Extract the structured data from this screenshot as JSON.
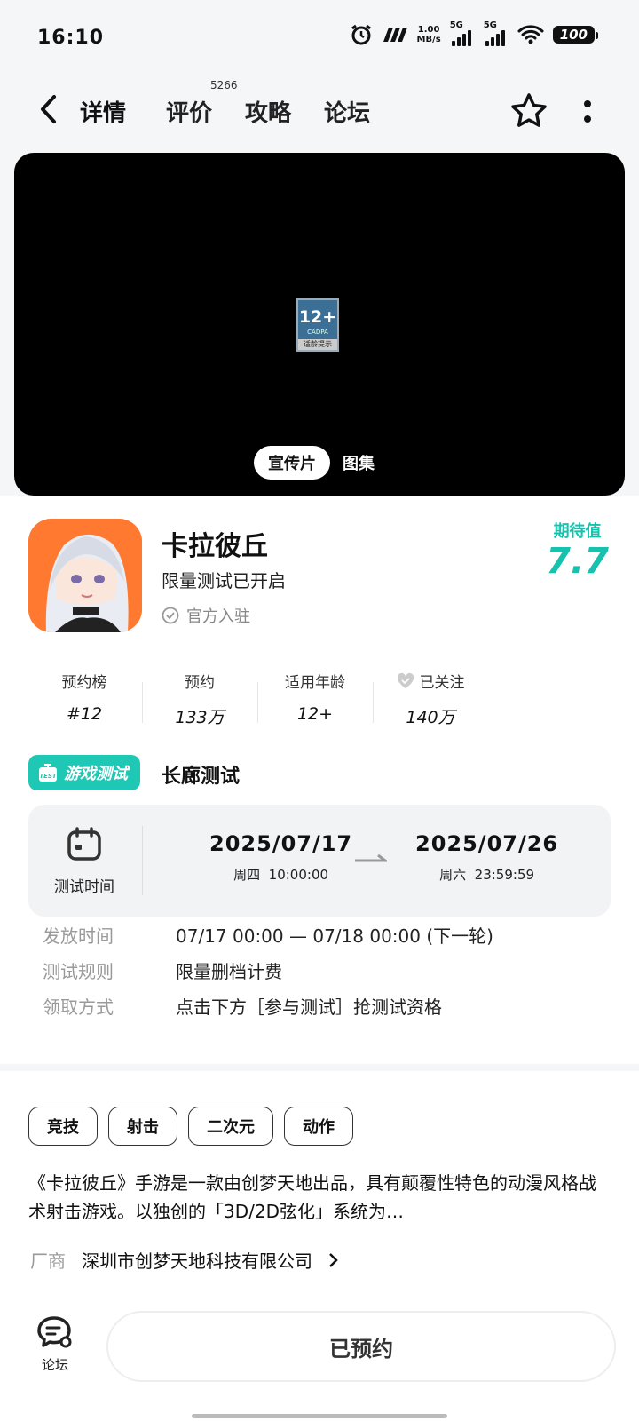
{
  "status": {
    "time": "16:10",
    "speed_value": "1.00",
    "speed_unit": "MB/s",
    "net1": "5G",
    "net2": "5G",
    "battery": "100"
  },
  "nav": {
    "tabs": [
      {
        "label": "详情",
        "active": true
      },
      {
        "label": "评价",
        "badge": "5266"
      },
      {
        "label": "攻略"
      },
      {
        "label": "论坛"
      }
    ]
  },
  "video": {
    "rating_num": "12+",
    "rating_org": "CADPA",
    "rating_tip": "适龄提示",
    "tabs": [
      {
        "label": "宣传片",
        "active": true
      },
      {
        "label": "图集"
      }
    ]
  },
  "app": {
    "title": "卡拉彼丘",
    "subtitle": "限量测试已开启",
    "official": "官方入驻",
    "expect_label": "期待值",
    "expect_value": "7.7"
  },
  "stats": [
    {
      "key": "预约榜",
      "value": "#12"
    },
    {
      "key": "预约",
      "value": "133万"
    },
    {
      "key": "适用年龄",
      "value": "12+"
    },
    {
      "key": "已关注",
      "value": "140万"
    }
  ],
  "test": {
    "tag": "游戏测试",
    "name": "长廊测试",
    "time_label": "测试时间",
    "start_date": "2025/07/17",
    "start_weekday": "周四",
    "start_time": "10:00:00",
    "end_date": "2025/07/26",
    "end_weekday": "周六",
    "end_time": "23:59:59",
    "info": [
      {
        "key": "发放时间",
        "value": "07/17 00:00 — 07/18 00:00 (下一轮)"
      },
      {
        "key": "测试规则",
        "value": "限量删档计费"
      },
      {
        "key": "领取方式",
        "value": "点击下方［参与测试］抢测试资格"
      }
    ]
  },
  "tags": [
    "竞技",
    "射击",
    "二次元",
    "动作"
  ],
  "description": "《卡拉彼丘》手游是一款由创梦天地出品，具有颠覆性特色的动漫风格战术射击游戏。以独创的「3D/2D弦化」系统为…",
  "vendor": {
    "label": "厂商",
    "name": "深圳市创梦天地科技有限公司"
  },
  "bottom": {
    "forum_label": "论坛",
    "reserve_label": "已预约"
  },
  "colors": {
    "accent": "#1ec8b4"
  }
}
